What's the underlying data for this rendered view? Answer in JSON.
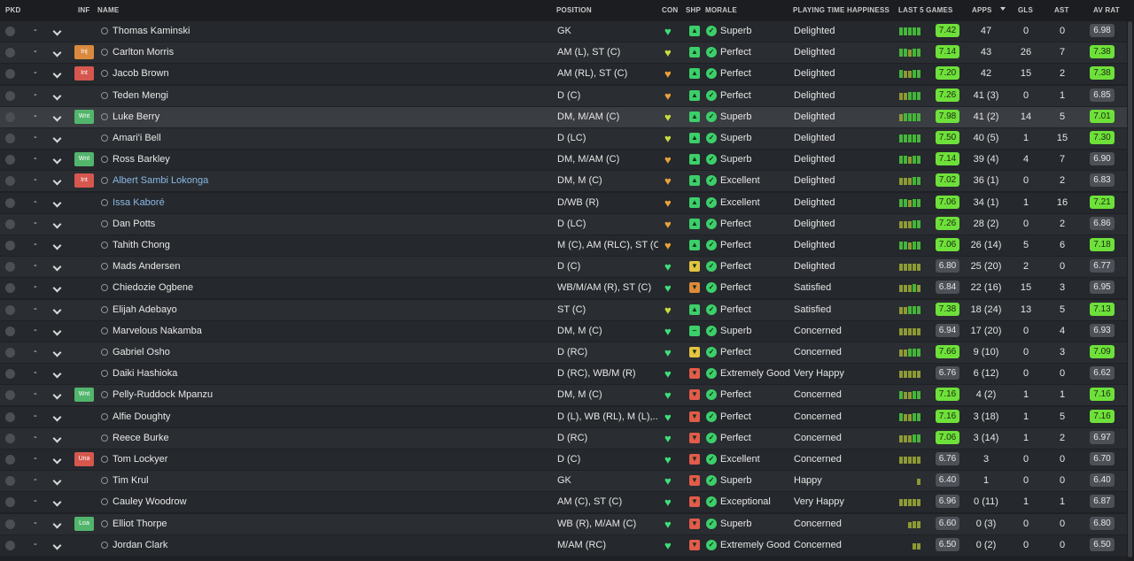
{
  "header": {
    "pkd": "PKD",
    "inf": "INF",
    "name": "NAME",
    "position": "POSITION",
    "con": "CON",
    "shp": "SHP",
    "morale": "MORALE",
    "happiness": "PLAYING TIME HAPPINESS",
    "last5": "LAST 5 GAMES",
    "apps": "APPS",
    "gls": "GLS",
    "ast": "AST",
    "avrat": "AV RAT"
  },
  "colors": {
    "bright_green": "#6ee03a",
    "mid_green": "#45b53a",
    "olive": "#8d9a34",
    "brown": "#9b7a36",
    "neutral": "#4d5157",
    "heart_green": "#3ee07a",
    "heart_yellow": "#c8de3c",
    "heart_orange": "#e9a23b",
    "shp_green": "#3ccf6a",
    "shp_yellow": "#e3c43f",
    "shp_orange": "#e08a3a",
    "shp_red": "#e35b4a"
  },
  "players": [
    {
      "pkd": "-",
      "inf": "",
      "name": "Thomas Kaminski",
      "link": false,
      "position": "GK",
      "con": "green",
      "shp": "green",
      "shp_icon": "up",
      "morale": "Superb",
      "happiness": "Delighted",
      "last5": [
        5,
        5,
        5,
        5,
        5
      ],
      "rating": "7.42",
      "apps": "47",
      "gls": "0",
      "ast": "0",
      "avrat": "6.98"
    },
    {
      "pkd": "-",
      "inf": "Inj",
      "name": "Carlton Morris",
      "link": false,
      "position": "AM (L), ST (C)",
      "con": "yellow",
      "shp": "green",
      "shp_icon": "up",
      "morale": "Perfect",
      "happiness": "Delighted",
      "last5": [
        5,
        5,
        4,
        5,
        5
      ],
      "rating": "7.14",
      "apps": "43",
      "gls": "26",
      "ast": "7",
      "avrat": "7.38"
    },
    {
      "pkd": "-",
      "inf": "Int",
      "name": "Jacob Brown",
      "link": false,
      "position": "AM (RL), ST (C)",
      "con": "orange",
      "shp": "green",
      "shp_icon": "up",
      "morale": "Perfect",
      "happiness": "Delighted",
      "last5": [
        5,
        4,
        4,
        5,
        5
      ],
      "rating": "7.20",
      "apps": "42",
      "gls": "15",
      "ast": "2",
      "avrat": "7.38"
    },
    {
      "pkd": "-",
      "inf": "",
      "name": "Teden Mengi",
      "link": false,
      "position": "D (C)",
      "con": "orange",
      "shp": "green",
      "shp_icon": "up",
      "morale": "Perfect",
      "happiness": "Delighted",
      "last5": [
        4,
        4,
        5,
        5,
        5
      ],
      "rating": "7.26",
      "apps": "41 (3)",
      "gls": "0",
      "ast": "1",
      "avrat": "6.85"
    },
    {
      "pkd": "-",
      "inf": "Wnt",
      "name": "Luke Berry",
      "link": false,
      "position": "DM, M/AM (C)",
      "con": "yellow",
      "shp": "green",
      "shp_icon": "up",
      "morale": "Superb",
      "happiness": "Delighted",
      "last5": [
        4,
        5,
        5,
        5,
        5
      ],
      "rating": "7.98",
      "apps": "41 (2)",
      "gls": "14",
      "ast": "5",
      "avrat": "7.01"
    },
    {
      "pkd": "-",
      "inf": "",
      "name": "Amari'i Bell",
      "link": false,
      "position": "D (LC)",
      "con": "yellow",
      "shp": "green",
      "shp_icon": "up",
      "morale": "Superb",
      "happiness": "Delighted",
      "last5": [
        5,
        5,
        5,
        5,
        5
      ],
      "rating": "7.50",
      "apps": "40 (5)",
      "gls": "1",
      "ast": "15",
      "avrat": "7.30"
    },
    {
      "pkd": "-",
      "inf": "Wnt",
      "name": "Ross Barkley",
      "link": false,
      "position": "DM, M/AM (C)",
      "con": "orange",
      "shp": "green",
      "shp_icon": "up",
      "morale": "Superb",
      "happiness": "Delighted",
      "last5": [
        5,
        5,
        4,
        5,
        5
      ],
      "rating": "7.14",
      "apps": "39 (4)",
      "gls": "4",
      "ast": "7",
      "avrat": "6.90"
    },
    {
      "pkd": "-",
      "inf": "Int",
      "name": "Albert Sambi Lokonga",
      "link": true,
      "position": "DM, M (C)",
      "con": "orange",
      "shp": "green",
      "shp_icon": "up",
      "morale": "Excellent",
      "happiness": "Delighted",
      "last5": [
        4,
        4,
        4,
        5,
        5
      ],
      "rating": "7.02",
      "apps": "36 (1)",
      "gls": "0",
      "ast": "2",
      "avrat": "6.83"
    },
    {
      "pkd": "-",
      "inf": "",
      "name": "Issa Kaboré",
      "link": true,
      "position": "D/WB (R)",
      "con": "orange",
      "shp": "green",
      "shp_icon": "up",
      "morale": "Excellent",
      "happiness": "Delighted",
      "last5": [
        5,
        5,
        4,
        5,
        5
      ],
      "rating": "7.06",
      "apps": "34 (1)",
      "gls": "1",
      "ast": "16",
      "avrat": "7.21"
    },
    {
      "pkd": "-",
      "inf": "",
      "name": "Dan Potts",
      "link": false,
      "position": "D (LC)",
      "con": "orange",
      "shp": "green",
      "shp_icon": "up",
      "morale": "Perfect",
      "happiness": "Delighted",
      "last5": [
        4,
        4,
        4,
        5,
        5
      ],
      "rating": "7.26",
      "apps": "28 (2)",
      "gls": "0",
      "ast": "2",
      "avrat": "6.86"
    },
    {
      "pkd": "-",
      "inf": "",
      "name": "Tahith Chong",
      "link": false,
      "position": "M (C), AM (RLC), ST (C)",
      "con": "orange",
      "shp": "green",
      "shp_icon": "up",
      "morale": "Perfect",
      "happiness": "Delighted",
      "last5": [
        5,
        5,
        4,
        5,
        5
      ],
      "rating": "7.06",
      "apps": "26 (14)",
      "gls": "5",
      "ast": "6",
      "avrat": "7.18"
    },
    {
      "pkd": "-",
      "inf": "",
      "name": "Mads Andersen",
      "link": false,
      "position": "D (C)",
      "con": "green",
      "shp": "yellow",
      "shp_icon": "down",
      "morale": "Perfect",
      "happiness": "Delighted",
      "last5": [
        4,
        4,
        4,
        4,
        4
      ],
      "rating": "6.80",
      "apps": "25 (20)",
      "gls": "2",
      "ast": "0",
      "avrat": "6.77"
    },
    {
      "pkd": "-",
      "inf": "",
      "name": "Chiedozie Ogbene",
      "link": false,
      "position": "WB/M/AM (R), ST (C)",
      "con": "green",
      "shp": "orange",
      "shp_icon": "down",
      "morale": "Perfect",
      "happiness": "Satisfied",
      "last5": [
        4,
        4,
        4,
        5,
        4
      ],
      "rating": "6.84",
      "apps": "22 (16)",
      "gls": "15",
      "ast": "3",
      "avrat": "6.95"
    },
    {
      "pkd": "-",
      "inf": "",
      "name": "Elijah Adebayo",
      "link": false,
      "position": "ST (C)",
      "con": "yellow",
      "shp": "green",
      "shp_icon": "up",
      "morale": "Perfect",
      "happiness": "Satisfied",
      "last5": [
        4,
        4,
        5,
        5,
        5
      ],
      "rating": "7.38",
      "apps": "18 (24)",
      "gls": "13",
      "ast": "5",
      "avrat": "7.13"
    },
    {
      "pkd": "-",
      "inf": "",
      "name": "Marvelous Nakamba",
      "link": false,
      "position": "DM, M (C)",
      "con": "green",
      "shp": "green",
      "shp_icon": "flat",
      "morale": "Superb",
      "happiness": "Concerned",
      "last5": [
        4,
        4,
        4,
        4,
        4
      ],
      "rating": "6.94",
      "apps": "17 (20)",
      "gls": "0",
      "ast": "4",
      "avrat": "6.93"
    },
    {
      "pkd": "-",
      "inf": "",
      "name": "Gabriel Osho",
      "link": false,
      "position": "D (RC)",
      "con": "green",
      "shp": "yellow",
      "shp_icon": "down",
      "morale": "Perfect",
      "happiness": "Concerned",
      "last5": [
        4,
        4,
        5,
        5,
        5
      ],
      "rating": "7.66",
      "apps": "9 (10)",
      "gls": "0",
      "ast": "3",
      "avrat": "7.09"
    },
    {
      "pkd": "-",
      "inf": "",
      "name": "Daiki Hashioka",
      "link": false,
      "position": "D (RC), WB/M (R)",
      "con": "green",
      "shp": "red",
      "shp_icon": "down",
      "morale": "Extremely Good",
      "happiness": "Very Happy",
      "last5": [
        4,
        4,
        4,
        4,
        4
      ],
      "rating": "6.76",
      "apps": "6 (12)",
      "gls": "0",
      "ast": "0",
      "avrat": "6.62"
    },
    {
      "pkd": "-",
      "inf": "Wnt",
      "name": "Pelly-Ruddock Mpanzu",
      "link": false,
      "position": "DM, M (C)",
      "con": "green",
      "shp": "red",
      "shp_icon": "down",
      "morale": "Perfect",
      "happiness": "Concerned",
      "last5": [
        5,
        4,
        4,
        5,
        5
      ],
      "rating": "7.16",
      "apps": "4 (2)",
      "gls": "1",
      "ast": "1",
      "avrat": "7.16"
    },
    {
      "pkd": "-",
      "inf": "",
      "name": "Alfie Doughty",
      "link": false,
      "position": "D (L), WB (RL), M (L),...",
      "con": "green",
      "shp": "red",
      "shp_icon": "down",
      "morale": "Perfect",
      "happiness": "Concerned",
      "last5": [
        5,
        4,
        4,
        5,
        5
      ],
      "rating": "7.16",
      "apps": "3 (18)",
      "gls": "1",
      "ast": "5",
      "avrat": "7.16"
    },
    {
      "pkd": "-",
      "inf": "",
      "name": "Reece Burke",
      "link": false,
      "position": "D (RC)",
      "con": "green",
      "shp": "red",
      "shp_icon": "down",
      "morale": "Perfect",
      "happiness": "Concerned",
      "last5": [
        4,
        4,
        4,
        5,
        5
      ],
      "rating": "7.06",
      "apps": "3 (14)",
      "gls": "1",
      "ast": "2",
      "avrat": "6.97"
    },
    {
      "pkd": "-",
      "inf": "Una",
      "name": "Tom Lockyer",
      "link": false,
      "position": "D (C)",
      "con": "green",
      "shp": "red",
      "shp_icon": "down",
      "morale": "Excellent",
      "happiness": "Concerned",
      "last5": [
        4,
        4,
        4,
        4,
        4
      ],
      "rating": "6.76",
      "apps": "3",
      "gls": "0",
      "ast": "0",
      "avrat": "6.70"
    },
    {
      "pkd": "-",
      "inf": "",
      "name": "Tim Krul",
      "link": false,
      "position": "GK",
      "con": "green",
      "shp": "red",
      "shp_icon": "down",
      "morale": "Superb",
      "happiness": "Happy",
      "last5": [
        0,
        0,
        0,
        0,
        3
      ],
      "rating": "6.40",
      "apps": "1",
      "gls": "0",
      "ast": "0",
      "avrat": "6.40"
    },
    {
      "pkd": "-",
      "inf": "",
      "name": "Cauley Woodrow",
      "link": false,
      "position": "AM (C), ST (C)",
      "con": "green",
      "shp": "red",
      "shp_icon": "down",
      "morale": "Exceptional",
      "happiness": "Very Happy",
      "last5": [
        4,
        4,
        4,
        4,
        4
      ],
      "rating": "6.96",
      "apps": "0 (11)",
      "gls": "1",
      "ast": "1",
      "avrat": "6.87"
    },
    {
      "pkd": "-",
      "inf": "Loa",
      "name": "Elliot Thorpe",
      "link": false,
      "position": "WB (R), M/AM (C)",
      "con": "green",
      "shp": "red",
      "shp_icon": "down",
      "morale": "Superb",
      "happiness": "Concerned",
      "last5": [
        0,
        0,
        3,
        4,
        4
      ],
      "rating": "6.60",
      "apps": "0 (3)",
      "gls": "0",
      "ast": "0",
      "avrat": "6.80"
    },
    {
      "pkd": "-",
      "inf": "",
      "name": "Jordan Clark",
      "link": false,
      "position": "M/AM (RC)",
      "con": "green",
      "shp": "red",
      "shp_icon": "down",
      "morale": "Extremely Good",
      "happiness": "Concerned",
      "last5": [
        0,
        0,
        0,
        3,
        3
      ],
      "rating": "6.50",
      "apps": "0 (2)",
      "gls": "0",
      "ast": "0",
      "avrat": "6.50"
    }
  ]
}
